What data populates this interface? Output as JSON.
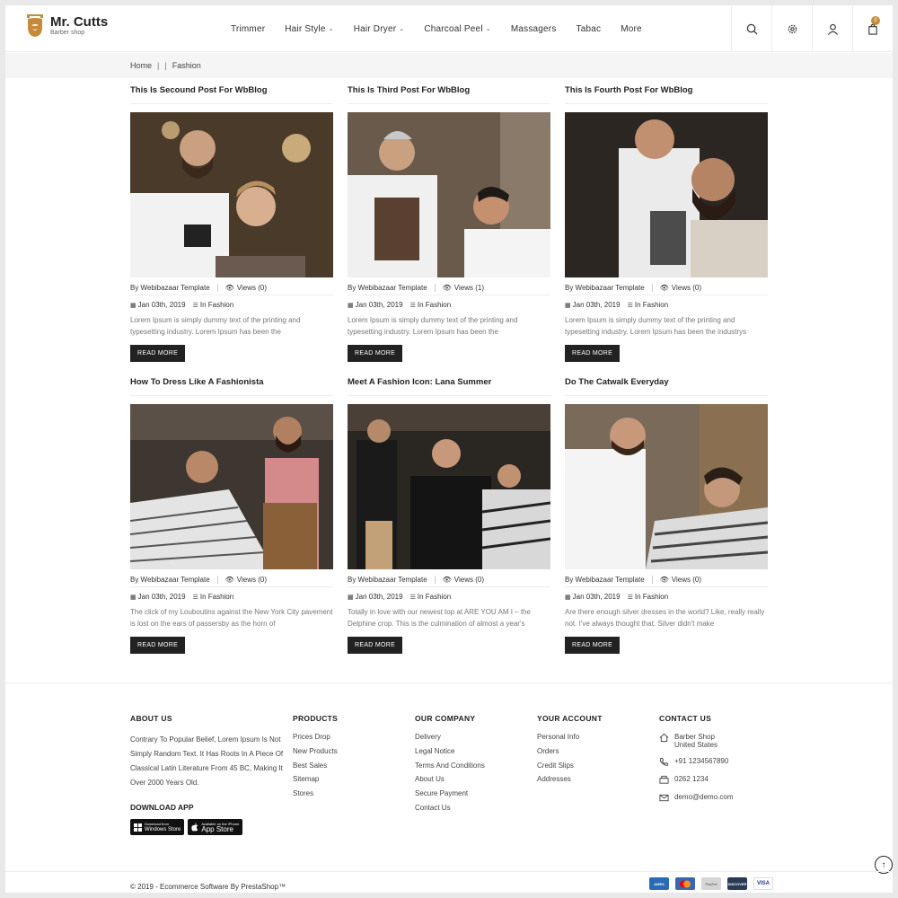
{
  "header": {
    "brand": "Mr. Cutts",
    "tagline": "Barber shop",
    "nav": [
      {
        "label": "Trimmer",
        "dropdown": false
      },
      {
        "label": "Hair Style",
        "dropdown": true
      },
      {
        "label": "Hair Dryer",
        "dropdown": true
      },
      {
        "label": "Charcoal Peel",
        "dropdown": true
      },
      {
        "label": "Massagers",
        "dropdown": false
      },
      {
        "label": "Tabac",
        "dropdown": false
      },
      {
        "label": "More",
        "dropdown": false
      }
    ],
    "cart_count": "0"
  },
  "breadcrumb": {
    "home": "Home",
    "sep1": "|",
    "sep2": "|",
    "current": "Fashion"
  },
  "posts": [
    {
      "title": "This Is Secound Post For WbBlog",
      "author": "By Webibazaar Template",
      "views": "Views (0)",
      "date": "Jan 03th, 2019",
      "category": "In Fashion",
      "excerpt": "Lorem Ipsum is simply dummy text of the printing and typesetting industry. Lorem Ipsum has been the",
      "button": "READ MORE"
    },
    {
      "title": "This Is Third Post For WbBlog",
      "author": "By Webibazaar Template",
      "views": "Views (1)",
      "date": "Jan 03th, 2019",
      "category": "In Fashion",
      "excerpt": "Lorem Ipsum is simply dummy text of the printing and typesetting industry. Lorem Ipsum has been the",
      "button": "READ MORE"
    },
    {
      "title": "This Is Fourth Post For WbBlog",
      "author": "By Webibazaar Template",
      "views": "Views (0)",
      "date": "Jan 03th, 2019",
      "category": "In Fashion",
      "excerpt": "Lorem Ipsum is simply dummy text of the printing and typesetting industry. Lorem Ipsum has been the industrys",
      "button": "READ MORE"
    },
    {
      "title": "How To Dress Like A Fashionista",
      "author": "By Webibazaar Template",
      "views": "Views (0)",
      "date": "Jan 03th, 2019",
      "category": "In Fashion",
      "excerpt": "The click of my Louboutins against the New York City pavement is lost on the ears of passersby as the horn of",
      "button": "READ MORE"
    },
    {
      "title": "Meet A Fashion Icon: Lana Summer",
      "author": "By Webibazaar Template",
      "views": "Views (0)",
      "date": "Jan 03th, 2019",
      "category": "In Fashion",
      "excerpt": "Totally in love with our newest top at ARE YOU AM I – the Delphine crop. This is the culmination of almost a year's",
      "button": "READ MORE"
    },
    {
      "title": "Do The Catwalk Everyday",
      "author": "By Webibazaar Template",
      "views": "Views (0)",
      "date": "Jan 03th, 2019",
      "category": "In Fashion",
      "excerpt": "Are there enough silver dresses in the world? Like, really really not. I've always thought that. Silver didn't make",
      "button": "READ MORE"
    }
  ],
  "footer": {
    "about": {
      "title": "ABOUT US",
      "text": "Contrary To Popular Belief, Lorem Ipsum Is Not Simply Random Text. It Has Roots In A Piece Of Classical Latin Literature From 45 BC, Making It Over 2000 Years Old.",
      "download_title": "DOWNLOAD APP",
      "windows_small": "Download from",
      "windows_big": "Windows Store",
      "apple_small": "Available on the iPhone",
      "apple_big": "App Store"
    },
    "products": {
      "title": "PRODUCTS",
      "items": [
        "Prices Drop",
        "New Products",
        "Best Sales",
        "Sitemap",
        "Stores"
      ]
    },
    "company": {
      "title": "OUR COMPANY",
      "items": [
        "Delivery",
        "Legal Notice",
        "Terms And Conditions",
        "About Us",
        "Secure Payment",
        "Contact Us"
      ]
    },
    "account": {
      "title": "YOUR ACCOUNT",
      "items": [
        "Personal Info",
        "Orders",
        "Credit Slips",
        "Addresses"
      ]
    },
    "contact": {
      "title": "CONTACT US",
      "address1": "Barber Shop",
      "address2": "United States",
      "phone": "+91 1234567890",
      "fax": "0262 1234",
      "email": "demo@demo.com"
    },
    "copyright": "© 2019 - Ecommerce Software By PrestaShop™"
  },
  "payments": [
    {
      "name": "AMEX",
      "color": "#2a6bb5"
    },
    {
      "name": "MC",
      "color": "#3a66b0"
    },
    {
      "name": "PayPal",
      "color": "#d5d5d5"
    },
    {
      "name": "DISCOVER",
      "color": "#2b3a55"
    },
    {
      "name": "VISA",
      "color": "#ffffff"
    }
  ]
}
